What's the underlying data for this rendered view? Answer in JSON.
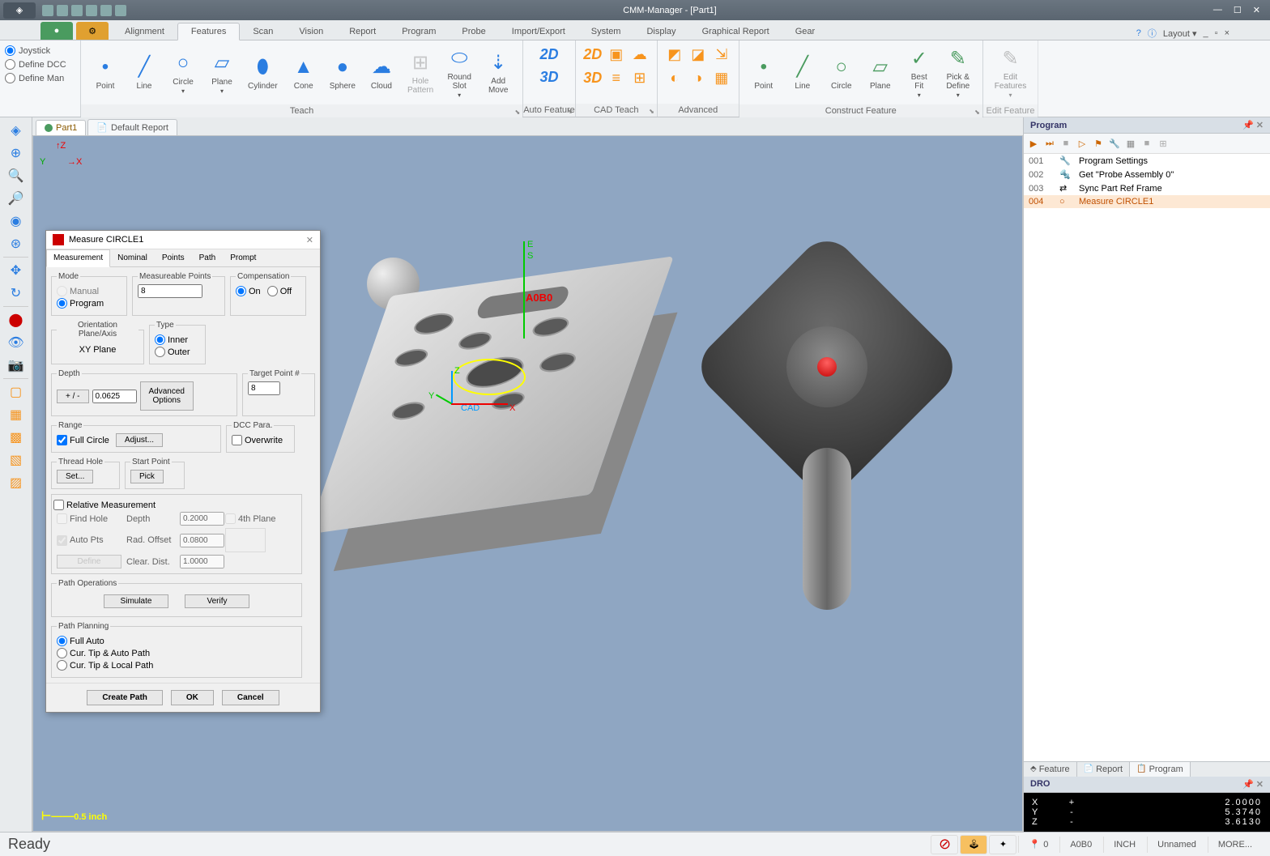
{
  "app": {
    "title": "CMM-Manager - [Part1]"
  },
  "qat_icons": [
    "new-icon",
    "open-icon",
    "save-icon",
    "undo-icon",
    "redo-icon",
    "settings-icon"
  ],
  "ribbon_tabs": [
    "Alignment",
    "Features",
    "Scan",
    "Vision",
    "Report",
    "Program",
    "Probe",
    "Import/Export",
    "System",
    "Display",
    "Graphical Report",
    "Gear"
  ],
  "active_ribbon_tab": "Features",
  "layout_label": "Layout",
  "mode_radios": [
    "Joystick",
    "Define DCC",
    "Define Man"
  ],
  "ribbon_groups": {
    "teach": {
      "label": "Teach",
      "items": [
        "Point",
        "Line",
        "Circle",
        "Plane",
        "Cylinder",
        "Cone",
        "Sphere",
        "Cloud",
        "Hole\nPattern",
        "Round\nSlot",
        "Add\nMove"
      ]
    },
    "auto": {
      "label": "Auto Feature",
      "items": [
        "2D",
        "3D"
      ]
    },
    "cadteach": {
      "label": "CAD Teach"
    },
    "advanced": {
      "label": "Advanced"
    },
    "construct": {
      "label": "Construct Feature",
      "items": [
        "Point",
        "Line",
        "Circle",
        "Plane",
        "Best\nFit",
        "Pick &\nDefine"
      ]
    },
    "edit": {
      "label": "Edit Feature",
      "item": "Edit\nFeatures"
    }
  },
  "doc_tabs": [
    "Part1",
    "Default Report"
  ],
  "left_tools": [
    "home",
    "zoom-in",
    "zoom-out",
    "zoom-fit",
    "zoom-window",
    "zoom-all",
    "pan",
    "rotate",
    "redraw",
    "view-iso",
    "view-top",
    "view-front",
    "cube-shaded",
    "cube-wire",
    "cube-hidden",
    "cube-solid",
    "cube-trans"
  ],
  "viewport": {
    "probe_label": "A0B0",
    "probe_es": [
      "E",
      "S"
    ],
    "cad_label": "CAD",
    "axes": {
      "x_top": "X",
      "y_top": "Y",
      "z_top": "Z",
      "x": "X",
      "y": "Y",
      "z": "Z"
    },
    "scale": "0.5 inch"
  },
  "program_panel": {
    "title": "Program",
    "toolbar": [
      "play",
      "ff",
      "stop",
      "play2",
      "flag",
      "wrench",
      "grid",
      "block",
      "pattern"
    ],
    "rows": [
      {
        "num": "001",
        "icon": "🔧",
        "text": "Program Settings"
      },
      {
        "num": "002",
        "icon": "🔩",
        "text": "Get \"Probe Assembly 0\""
      },
      {
        "num": "003",
        "icon": "⇄",
        "text": "Sync Part Ref Frame"
      },
      {
        "num": "004",
        "icon": "○",
        "text": "Measure CIRCLE1",
        "selected": true
      }
    ],
    "tabs": [
      "Feature",
      "Report",
      "Program"
    ]
  },
  "dro": {
    "title": "DRO",
    "rows": [
      {
        "label": "X",
        "sign": "+",
        "value": "2.0000"
      },
      {
        "label": "Y",
        "sign": "-",
        "value": "5.3740"
      },
      {
        "label": "Z",
        "sign": "-",
        "value": "3.6130"
      }
    ]
  },
  "dialog": {
    "title": "Measure CIRCLE1",
    "tabs": [
      "Measurement",
      "Nominal",
      "Points",
      "Path",
      "Prompt"
    ],
    "active_tab": "Measurement",
    "mode": {
      "legend": "Mode",
      "manual": "Manual",
      "program": "Program"
    },
    "meas_pts": {
      "legend": "Measureable Points",
      "value": "8"
    },
    "compensation": {
      "legend": "Compensation",
      "on": "On",
      "off": "Off"
    },
    "orientation": {
      "legend": "Orientation Plane/Axis",
      "value": "XY Plane"
    },
    "type": {
      "legend": "Type",
      "inner": "Inner",
      "outer": "Outer"
    },
    "depth": {
      "legend": "Depth",
      "toggle": "+ / -",
      "value": "0.0625",
      "adv": "Advanced\nOptions"
    },
    "target": {
      "legend": "Target Point #",
      "value": "8"
    },
    "range": {
      "legend": "Range",
      "full": "Full Circle",
      "adjust": "Adjust..."
    },
    "dcc": {
      "legend": "DCC Para.",
      "overwrite": "Overwrite"
    },
    "thread": {
      "legend": "Thread Hole",
      "set": "Set..."
    },
    "start": {
      "legend": "Start Point",
      "pick": "Pick"
    },
    "relative": {
      "label": "Relative Measurement",
      "find_hole": "Find Hole",
      "auto_pts": "Auto Pts",
      "define": "Define",
      "depth_l": "Depth",
      "depth_v": "0.2000",
      "rad_l": "Rad. Offset",
      "rad_v": "0.0800",
      "clear_l": "Clear. Dist.",
      "clear_v": "1.0000",
      "fourth": "4th Plane"
    },
    "pathops": {
      "legend": "Path Operations",
      "sim": "Simulate",
      "ver": "Verify"
    },
    "pathplan": {
      "legend": "Path Planning",
      "full": "Full Auto",
      "tip_auto": "Cur. Tip & Auto Path",
      "tip_local": "Cur. Tip & Local Path"
    },
    "buttons": {
      "create": "Create Path",
      "ok": "OK",
      "cancel": "Cancel"
    }
  },
  "status": {
    "ready": "Ready",
    "cells": [
      "0",
      "A0B0",
      "INCH",
      "Unnamed",
      "MORE..."
    ]
  }
}
